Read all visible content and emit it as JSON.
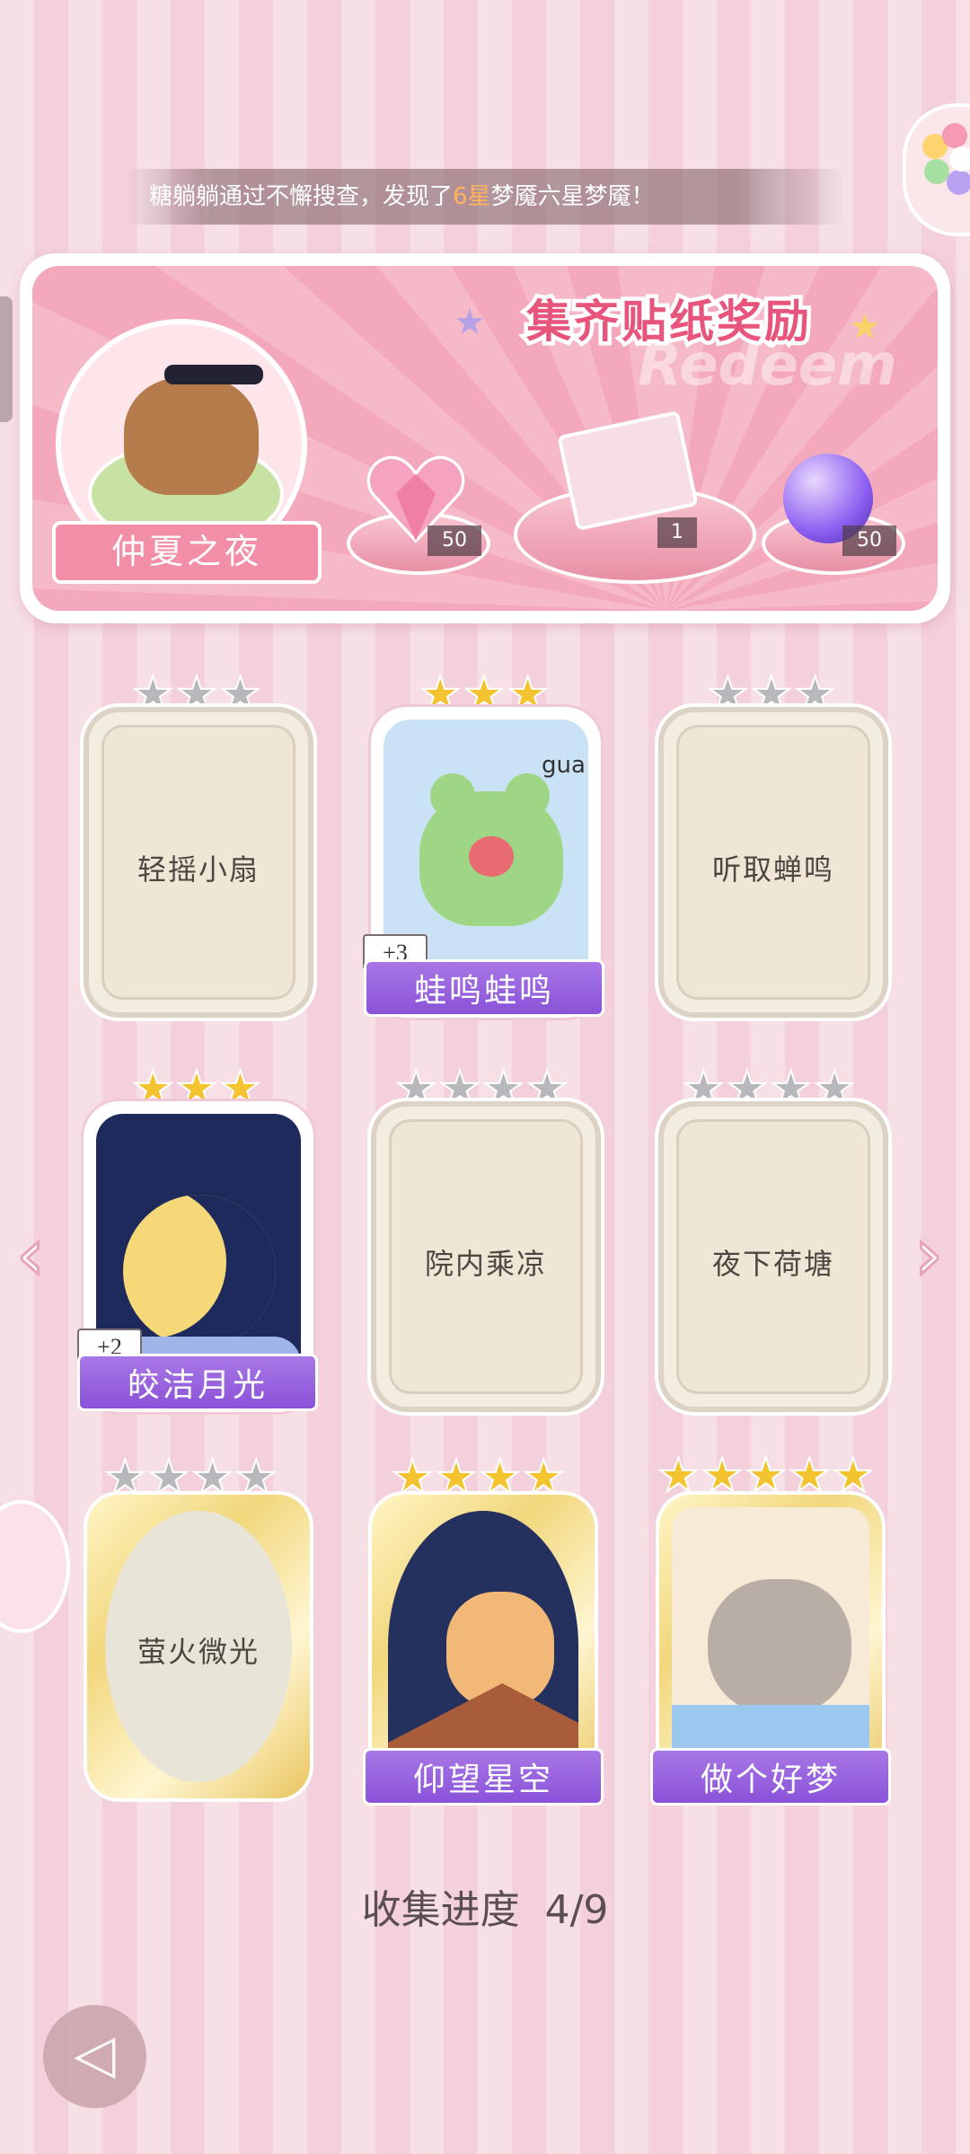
{
  "notice": {
    "prefix": "糖躺躺通过不懈搜查，发现了",
    "highlight": "6星",
    "suffix": "梦魇六星梦魇！"
  },
  "reward_panel": {
    "title": "集齐贴纸奖励",
    "watermark": "Redeem",
    "album_name": "仲夏之夜",
    "rewards": [
      {
        "icon": "pink-heart-gem-icon",
        "quantity": "50"
      },
      {
        "icon": "gift-box-icon",
        "quantity": "1"
      },
      {
        "icon": "purple-energy-orb-icon",
        "quantity": "50"
      }
    ]
  },
  "stickers": [
    {
      "name": "轻摇小扇",
      "stars": 3,
      "collected": false,
      "style": "blank"
    },
    {
      "name": "蛙鸣蛙鸣",
      "stars": 3,
      "collected": true,
      "extra": "+3",
      "caption": "gua",
      "style": "photo"
    },
    {
      "name": "听取蝉鸣",
      "stars": 3,
      "collected": false,
      "style": "blank"
    },
    {
      "name": "皎洁月光",
      "stars": 3,
      "collected": true,
      "extra": "+2",
      "style": "photo"
    },
    {
      "name": "院内乘凉",
      "stars": 4,
      "collected": false,
      "style": "blank"
    },
    {
      "name": "夜下荷塘",
      "stars": 4,
      "collected": false,
      "style": "blank"
    },
    {
      "name": "萤火微光",
      "stars": 4,
      "collected": false,
      "style": "gold"
    },
    {
      "name": "仰望星空",
      "stars": 4,
      "collected": true,
      "style": "gold-photo"
    },
    {
      "name": "做个好梦",
      "stars": 5,
      "collected": true,
      "style": "gold-photo"
    }
  ],
  "progress": {
    "label": "收集进度",
    "value": "4/9"
  },
  "colors": {
    "accent_purple": "#8a52d8",
    "star_gold": "#f4c330",
    "star_gray": "#b8b8bc",
    "title_pink": "#e8557c"
  }
}
